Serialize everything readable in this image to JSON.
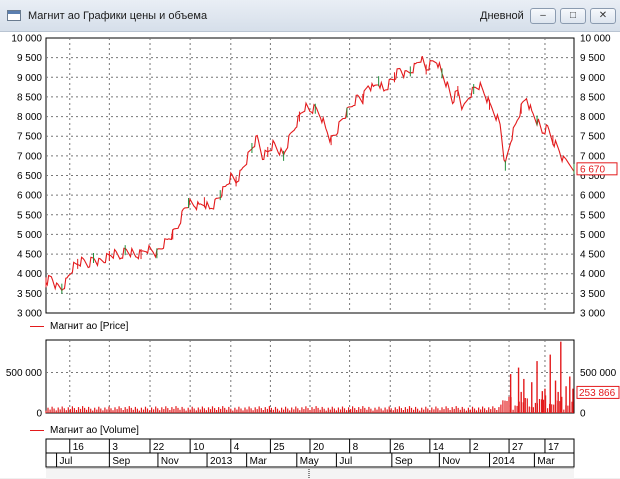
{
  "window": {
    "title": "Магнит ао Графики цены и объема",
    "period": "Дневной",
    "buttons": {
      "minimize": "–",
      "maximize": "□",
      "close": "✕"
    }
  },
  "chart_data": [
    {
      "type": "line",
      "series": [
        {
          "name": "Магнит ао [Price]",
          "color": "#e31a1c"
        }
      ],
      "legend": "Магнит ао [Price]",
      "ylim": [
        3000,
        10000
      ],
      "yticks": [
        "10 000",
        "9 500",
        "9 000",
        "8 500",
        "8 000",
        "7 500",
        "7 000",
        "6 500",
        "6 000",
        "5 500",
        "5 000",
        "4 500",
        "4 000",
        "3 500",
        "3 000"
      ],
      "last_value_label": "6 670",
      "last_value": 6670,
      "grid": true,
      "path": [
        [
          0,
          3780
        ],
        [
          0.01,
          3900
        ],
        [
          0.02,
          3650
        ],
        [
          0.03,
          3620
        ],
        [
          0.04,
          3850
        ],
        [
          0.05,
          4150
        ],
        [
          0.06,
          4250
        ],
        [
          0.07,
          4320
        ],
        [
          0.08,
          4250
        ],
        [
          0.09,
          4400
        ],
        [
          0.1,
          4300
        ],
        [
          0.11,
          4350
        ],
        [
          0.12,
          4450
        ],
        [
          0.13,
          4500
        ],
        [
          0.14,
          4420
        ],
        [
          0.15,
          4600
        ],
        [
          0.16,
          4550
        ],
        [
          0.17,
          4450
        ],
        [
          0.18,
          4500
        ],
        [
          0.19,
          4650
        ],
        [
          0.2,
          4600
        ],
        [
          0.21,
          4520
        ],
        [
          0.22,
          4700
        ],
        [
          0.23,
          4850
        ],
        [
          0.24,
          5000
        ],
        [
          0.25,
          5200
        ],
        [
          0.26,
          5600
        ],
        [
          0.27,
          5800
        ],
        [
          0.28,
          5750
        ],
        [
          0.29,
          5700
        ],
        [
          0.3,
          5820
        ],
        [
          0.31,
          5650
        ],
        [
          0.32,
          5800
        ],
        [
          0.33,
          6000
        ],
        [
          0.34,
          6200
        ],
        [
          0.35,
          6450
        ],
        [
          0.36,
          6350
        ],
        [
          0.37,
          6600
        ],
        [
          0.38,
          6900
        ],
        [
          0.39,
          7200
        ],
        [
          0.4,
          7450
        ],
        [
          0.41,
          7000
        ],
        [
          0.42,
          7100
        ],
        [
          0.43,
          7300
        ],
        [
          0.44,
          7150
        ],
        [
          0.45,
          7000
        ],
        [
          0.46,
          7400
        ],
        [
          0.47,
          7700
        ],
        [
          0.48,
          8000
        ],
        [
          0.49,
          8250
        ],
        [
          0.5,
          8150
        ],
        [
          0.51,
          8200
        ],
        [
          0.52,
          8050
        ],
        [
          0.53,
          7700
        ],
        [
          0.54,
          7400
        ],
        [
          0.55,
          7600
        ],
        [
          0.56,
          7900
        ],
        [
          0.57,
          8100
        ],
        [
          0.58,
          8300
        ],
        [
          0.59,
          8500
        ],
        [
          0.6,
          8450
        ],
        [
          0.61,
          8800
        ],
        [
          0.62,
          8700
        ],
        [
          0.63,
          8900
        ],
        [
          0.64,
          8650
        ],
        [
          0.65,
          8850
        ],
        [
          0.66,
          9000
        ],
        [
          0.67,
          9200
        ],
        [
          0.68,
          9050
        ],
        [
          0.69,
          9150
        ],
        [
          0.7,
          9300
        ],
        [
          0.71,
          9500
        ],
        [
          0.72,
          9200
        ],
        [
          0.73,
          9350
        ],
        [
          0.74,
          9450
        ],
        [
          0.75,
          9100
        ],
        [
          0.76,
          8800
        ],
        [
          0.77,
          8400
        ],
        [
          0.78,
          8650
        ],
        [
          0.79,
          8150
        ],
        [
          0.8,
          8500
        ],
        [
          0.81,
          8700
        ],
        [
          0.82,
          8800
        ],
        [
          0.83,
          8600
        ],
        [
          0.84,
          8300
        ],
        [
          0.85,
          8100
        ],
        [
          0.86,
          7800
        ],
        [
          0.87,
          6750
        ],
        [
          0.88,
          7400
        ],
        [
          0.89,
          7800
        ],
        [
          0.9,
          8200
        ],
        [
          0.91,
          8500
        ],
        [
          0.92,
          8100
        ],
        [
          0.93,
          7900
        ],
        [
          0.94,
          7600
        ],
        [
          0.95,
          7700
        ],
        [
          0.96,
          7400
        ],
        [
          0.97,
          7200
        ],
        [
          0.98,
          6900
        ],
        [
          1.0,
          6670
        ]
      ]
    },
    {
      "type": "bar",
      "series": [
        {
          "name": "Магнит ао [Volume]",
          "color": "#e31a1c"
        }
      ],
      "legend": "Магнит ао [Volume]",
      "ylim": [
        0,
        900000
      ],
      "yticks": [
        "500 000",
        "0"
      ],
      "last_value_label": "253 866",
      "last_value": 253866,
      "grid": true,
      "spikes": [
        [
          0.88,
          480000
        ],
        [
          0.895,
          560000
        ],
        [
          0.905,
          420000
        ],
        [
          0.92,
          380000
        ],
        [
          0.93,
          640000
        ],
        [
          0.945,
          300000
        ],
        [
          0.955,
          720000
        ],
        [
          0.965,
          400000
        ],
        [
          0.975,
          880000
        ],
        [
          0.985,
          330000
        ],
        [
          0.992,
          450000
        ],
        [
          0.998,
          300000
        ],
        [
          0.9,
          260000
        ],
        [
          0.94,
          270000
        ],
        [
          0.97,
          260000
        ]
      ]
    }
  ],
  "x_axis": {
    "top_row": [
      {
        "label": "16",
        "pos": 0.045
      },
      {
        "label": "3",
        "pos": 0.12
      },
      {
        "label": "22",
        "pos": 0.197
      },
      {
        "label": "10",
        "pos": 0.273
      },
      {
        "label": "4",
        "pos": 0.35
      },
      {
        "label": "25",
        "pos": 0.425
      },
      {
        "label": "20",
        "pos": 0.5
      },
      {
        "label": "8",
        "pos": 0.575
      },
      {
        "label": "26",
        "pos": 0.652
      },
      {
        "label": "14",
        "pos": 0.727
      },
      {
        "label": "2",
        "pos": 0.803
      },
      {
        "label": "27",
        "pos": 0.877
      },
      {
        "label": "17",
        "pos": 0.945
      }
    ],
    "bottom_row": [
      {
        "label": "Jul",
        "pos": 0.02
      },
      {
        "label": "Sep",
        "pos": 0.12
      },
      {
        "label": "Nov",
        "pos": 0.212
      },
      {
        "label": "2013",
        "pos": 0.305
      },
      {
        "label": "Mar",
        "pos": 0.38
      },
      {
        "label": "May",
        "pos": 0.475
      },
      {
        "label": "Jul",
        "pos": 0.55
      },
      {
        "label": "Sep",
        "pos": 0.655
      },
      {
        "label": "Nov",
        "pos": 0.745
      },
      {
        "label": "2014",
        "pos": 0.84
      },
      {
        "label": "Mar",
        "pos": 0.925
      }
    ]
  }
}
